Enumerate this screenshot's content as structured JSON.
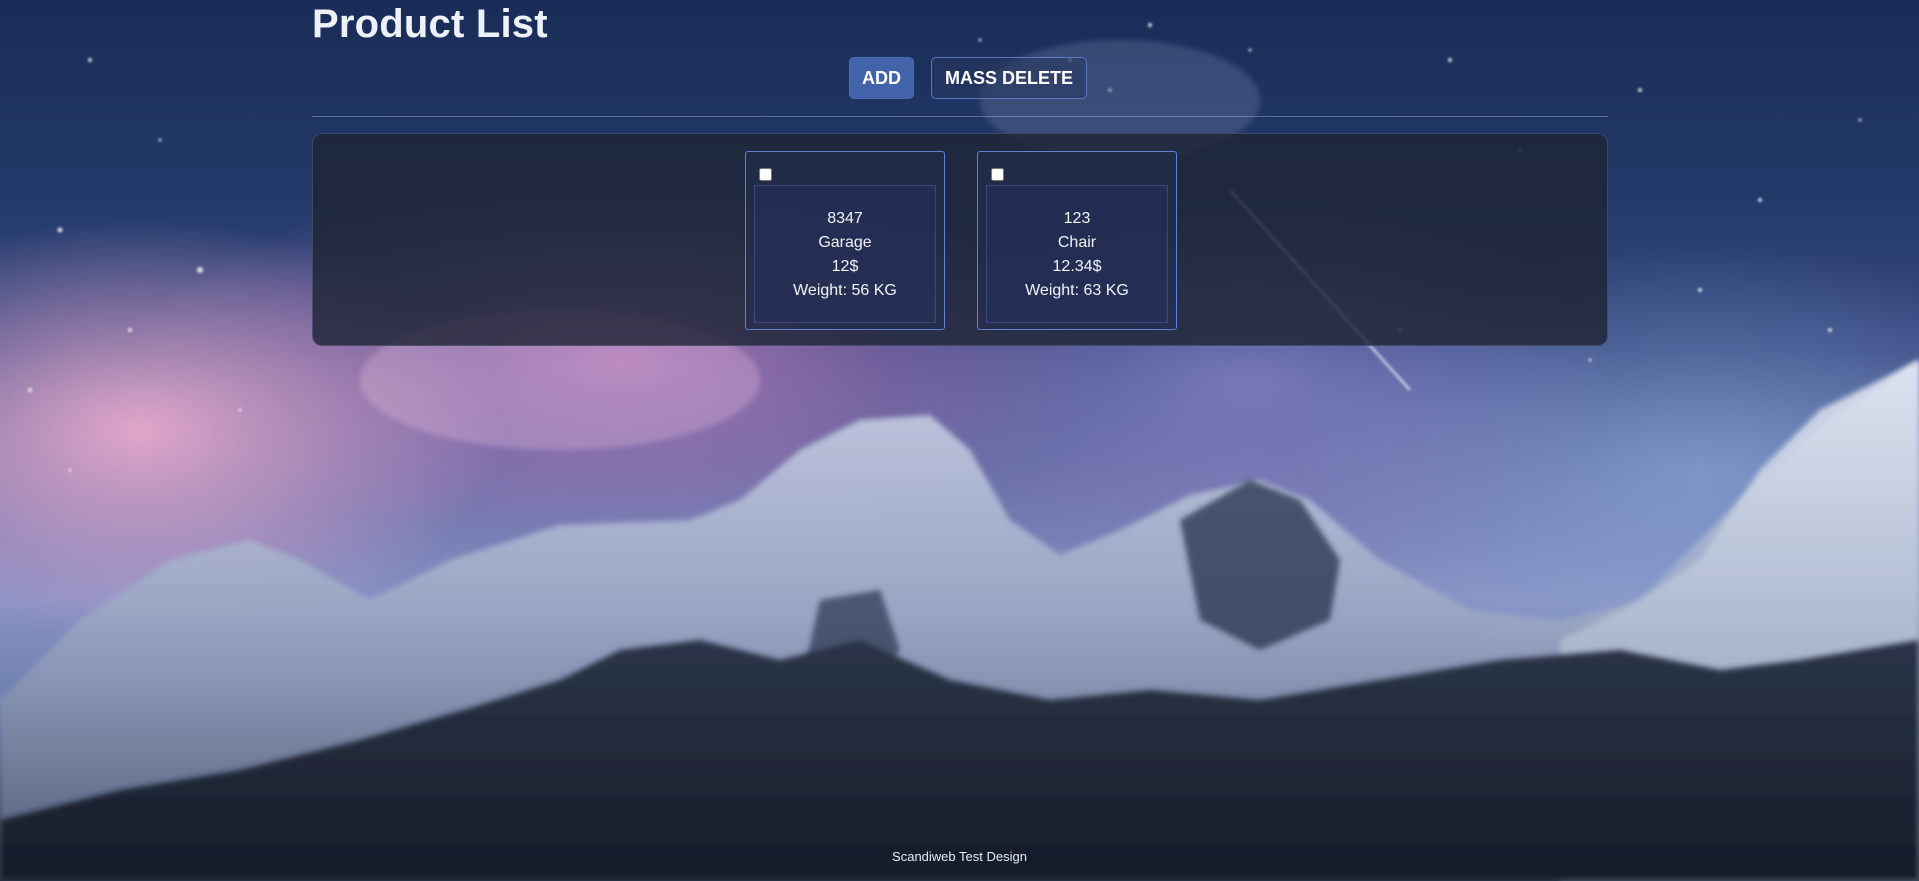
{
  "page": {
    "title": "Product List"
  },
  "toolbar": {
    "add_label": "ADD",
    "mass_delete_label": "MASS DELETE"
  },
  "products": [
    {
      "sku": "8347",
      "name": "Garage",
      "price": "12$",
      "attribute": "Weight: 56 KG",
      "checked": false
    },
    {
      "sku": "123",
      "name": "Chair",
      "price": "12.34$",
      "attribute": "Weight: 63 KG",
      "checked": false
    }
  ],
  "footer": {
    "text": "Scandiweb Test Design"
  },
  "colors": {
    "add_button": "#4262a9",
    "card_border": "#5f82d8",
    "panel": "#1e2436"
  }
}
